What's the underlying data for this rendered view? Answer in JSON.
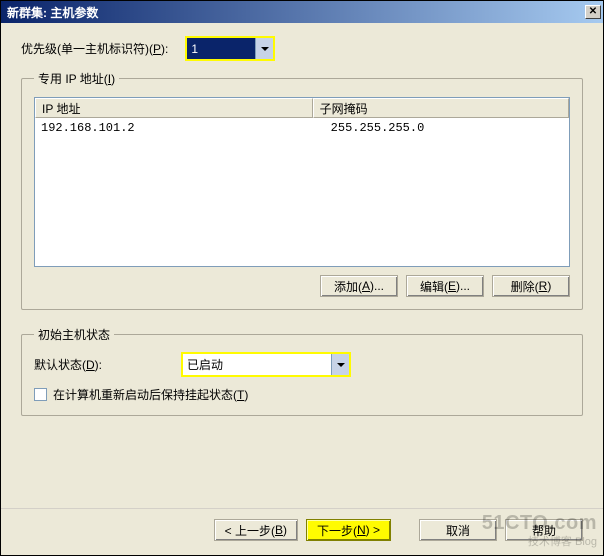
{
  "title": "新群集:  主机参数",
  "priority": {
    "label_pre": "优先级(单一主机标识符)(",
    "mnemonic": "P",
    "label_post": "):",
    "value": "1"
  },
  "ip_group": {
    "legend_pre": "专用 IP 地址(",
    "legend_mnemonic": "I",
    "legend_post": ")",
    "columns": {
      "ip": "IP 地址",
      "mask": "子网掩码"
    },
    "rows": [
      {
        "ip": "192.168.101.2",
        "mask": "255.255.255.0"
      }
    ],
    "buttons": {
      "add": {
        "pre": "添加(",
        "mnemonic": "A",
        "post": ")..."
      },
      "edit": {
        "pre": "编辑(",
        "mnemonic": "E",
        "post": ")..."
      },
      "remove": {
        "pre": "删除(",
        "mnemonic": "R",
        "post": ")"
      }
    }
  },
  "state_group": {
    "legend": "初始主机状态",
    "default_state": {
      "label_pre": "默认状态(",
      "mnemonic": "D",
      "label_post": "):",
      "value": "已启动"
    },
    "keep_suspended": {
      "label_pre": "在计算机重新启动后保持挂起状态(",
      "mnemonic": "T",
      "label_post": ")",
      "checked": false
    }
  },
  "wizard_buttons": {
    "back": {
      "pre": "< 上一步(",
      "mnemonic": "B",
      "post": ")"
    },
    "next": {
      "pre": "下一步(",
      "mnemonic": "N",
      "post": ") >"
    },
    "cancel": "取消",
    "help": "帮助"
  },
  "watermark": {
    "line1": "51CTO.com",
    "line2": "技术博客 Blog"
  }
}
